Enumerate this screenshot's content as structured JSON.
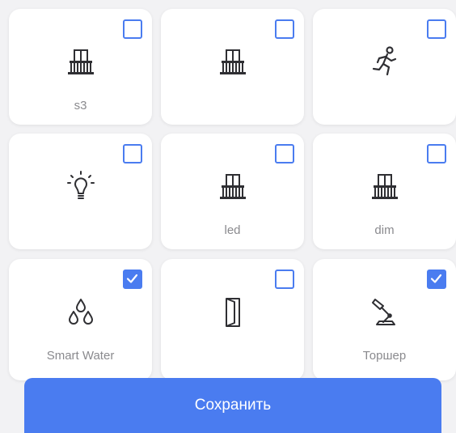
{
  "devices": [
    {
      "label": "s3",
      "icon": "balcony-icon",
      "checked": false
    },
    {
      "label": "",
      "icon": "balcony-icon",
      "checked": false
    },
    {
      "label": "",
      "icon": "running-person-icon",
      "checked": false
    },
    {
      "label": "",
      "icon": "lightbulb-icon",
      "checked": false
    },
    {
      "label": "led",
      "icon": "balcony-icon",
      "checked": false
    },
    {
      "label": "dim",
      "icon": "balcony-icon",
      "checked": false
    },
    {
      "label": "Smart Water",
      "icon": "water-drops-icon",
      "checked": true
    },
    {
      "label": "",
      "icon": "door-icon",
      "checked": false
    },
    {
      "label": "Торшер",
      "icon": "desk-lamp-icon",
      "checked": true
    }
  ],
  "save_label": "Сохранить",
  "colors": {
    "accent": "#4a7cf0",
    "label": "#8a8a8e",
    "background": "#f2f2f4"
  }
}
